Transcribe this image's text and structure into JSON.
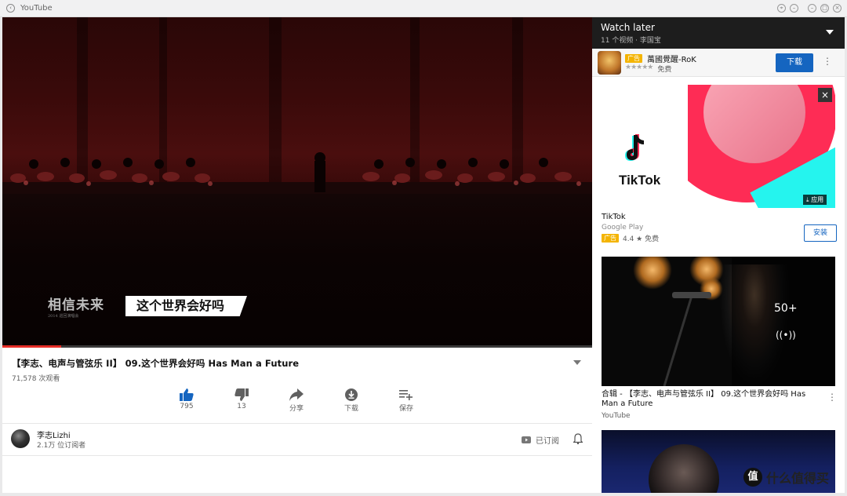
{
  "window": {
    "title": "YouTube"
  },
  "player": {
    "subtitle_left": "相信未来",
    "subtitle_left_small": "2014 巡回演唱会",
    "subtitle_main": "这个世界会好吗",
    "progress": 0.1
  },
  "video": {
    "title": "【李志、电声与管弦乐 II】 09.这个世界会好吗 Has Man a Future",
    "views": "71,578 次观看",
    "actions": [
      {
        "icon": "thumbs-up-icon",
        "label": "795"
      },
      {
        "icon": "thumbs-down-icon",
        "label": "13"
      },
      {
        "icon": "share-icon",
        "label": "分享"
      },
      {
        "icon": "download-icon",
        "label": "下载"
      },
      {
        "icon": "save-playlist-icon",
        "label": "保存"
      }
    ]
  },
  "channel": {
    "name": "李志Lizhi",
    "subscribers": "2.1万 位订阅者",
    "subscribed_label": "已订阅"
  },
  "watch_later": {
    "title": "Watch later",
    "subtitle": "11 个视频 · 李国宝"
  },
  "ad_banner": {
    "badge": "广告",
    "name": "萬國覺醒-RoK",
    "stars": "★★★★★",
    "price": "免费",
    "button": "下载"
  },
  "ad_tiktok": {
    "brand": "TikTok",
    "app_tag": "⤓ 应用",
    "name": "TikTok",
    "store": "Google Play",
    "badge": "广告",
    "rating": "4.4 ★ 免费",
    "install": "安装"
  },
  "mix": {
    "count": "50+",
    "title": "合辑 - 【李志、电声与管弦乐 II】 09.这个世界会好吗 Has Man a Future",
    "channel": "YouTube"
  },
  "watermark": {
    "glyph": "值",
    "text": "什么值得买"
  },
  "colors": {
    "accent_red": "#e52d27",
    "button_blue": "#1565c0",
    "tiktok_pink": "#fe2c55",
    "tiktok_cyan": "#25f4ee",
    "ad_badge": "#f4b400"
  }
}
